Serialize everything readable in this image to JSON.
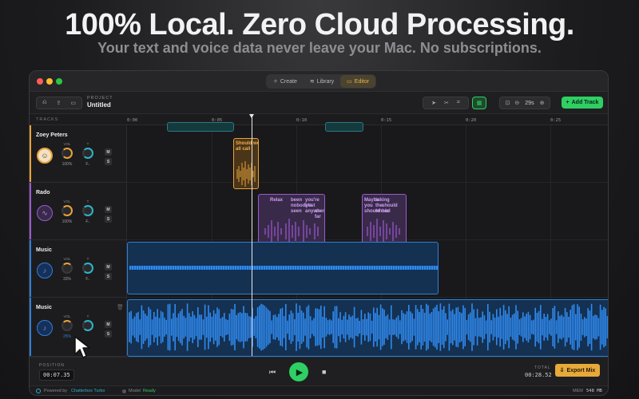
{
  "hero": {
    "title": "100% Local. Zero Cloud Processing.",
    "subtitle": "Your text and voice data never leave your Mac. No subscriptions."
  },
  "window": {
    "nav_tabs": [
      {
        "label": "Create",
        "icon": "sparkle-icon"
      },
      {
        "label": "Library",
        "icon": "layers-icon"
      },
      {
        "label": "Editor",
        "icon": "editor-icon",
        "active": true
      }
    ]
  },
  "toolbar": {
    "project_label": "PROJECT",
    "project_name": "Untitled",
    "zoom_value": "29s",
    "add_track_label": "Add Track"
  },
  "timeline": {
    "tracks_label": "TRACKS",
    "ruler_ticks": [
      "0:00",
      "0:05",
      "0:10",
      "0:15",
      "0:20",
      "0:25"
    ]
  },
  "tracks": [
    {
      "name": "Zoey Peters",
      "color": "#e8a23a",
      "avatar": "person-avatar",
      "vol_label": "VOL",
      "vol_value": "100%",
      "t_label": "T",
      "t_value": "F..",
      "clips": [
        {
          "text": "Should we all call",
          "color": "#e8a23a"
        }
      ]
    },
    {
      "name": "Rado",
      "color": "#9b5ad1",
      "avatar": "waveform-avatar",
      "vol_label": "VOL",
      "vol_value": "100%",
      "t_label": "T",
      "t_value": "F..",
      "clips": [
        {
          "text": "Relax",
          "color": "#9b5ad1"
        },
        {
          "text": "been nobody's seen",
          "color": "#9b5ad1"
        },
        {
          "text": "you're best anywhere",
          "color": "#9b5ad1"
        },
        {
          "text": "so far",
          "color": "#9b5ad1"
        },
        {
          "text": "Maybe you should",
          "color": "#9b5ad1"
        },
        {
          "text": "taking the whole",
          "color": "#9b5ad1"
        },
        {
          "text": "should had",
          "color": "#9b5ad1"
        }
      ]
    },
    {
      "name": "Music",
      "color": "#2f7fd8",
      "avatar": "music-note-icon",
      "vol_label": "VOL",
      "vol_value": "33%",
      "t_label": "T",
      "t_value": "F..",
      "clips": [
        {
          "text": "",
          "color": "#2f7fd8"
        }
      ]
    },
    {
      "name": "Music",
      "color": "#2f7fd8",
      "avatar": "music-note-icon",
      "vol_label": "VOL",
      "vol_value": "25%",
      "t_label": "T",
      "t_value": "F..",
      "clips": [
        {
          "text": "",
          "color": "#2f7fd8"
        }
      ]
    }
  ],
  "mute_label": "M",
  "solo_label": "S",
  "transport": {
    "position_label": "POSITION",
    "position_value": "00:07.35",
    "total_label": "TOTAL",
    "total_value": "00:28.52",
    "export_label": "Export Mix"
  },
  "status": {
    "powered_prefix": "Powered by",
    "powered_name": "Chatterbox Turbo",
    "model_prefix": "Model",
    "model_value": "Ready",
    "mem_label": "MEM",
    "mem_value": "548 MB"
  },
  "colors": {
    "accent_green": "#2fcf63",
    "accent_orange": "#e6a93a"
  }
}
